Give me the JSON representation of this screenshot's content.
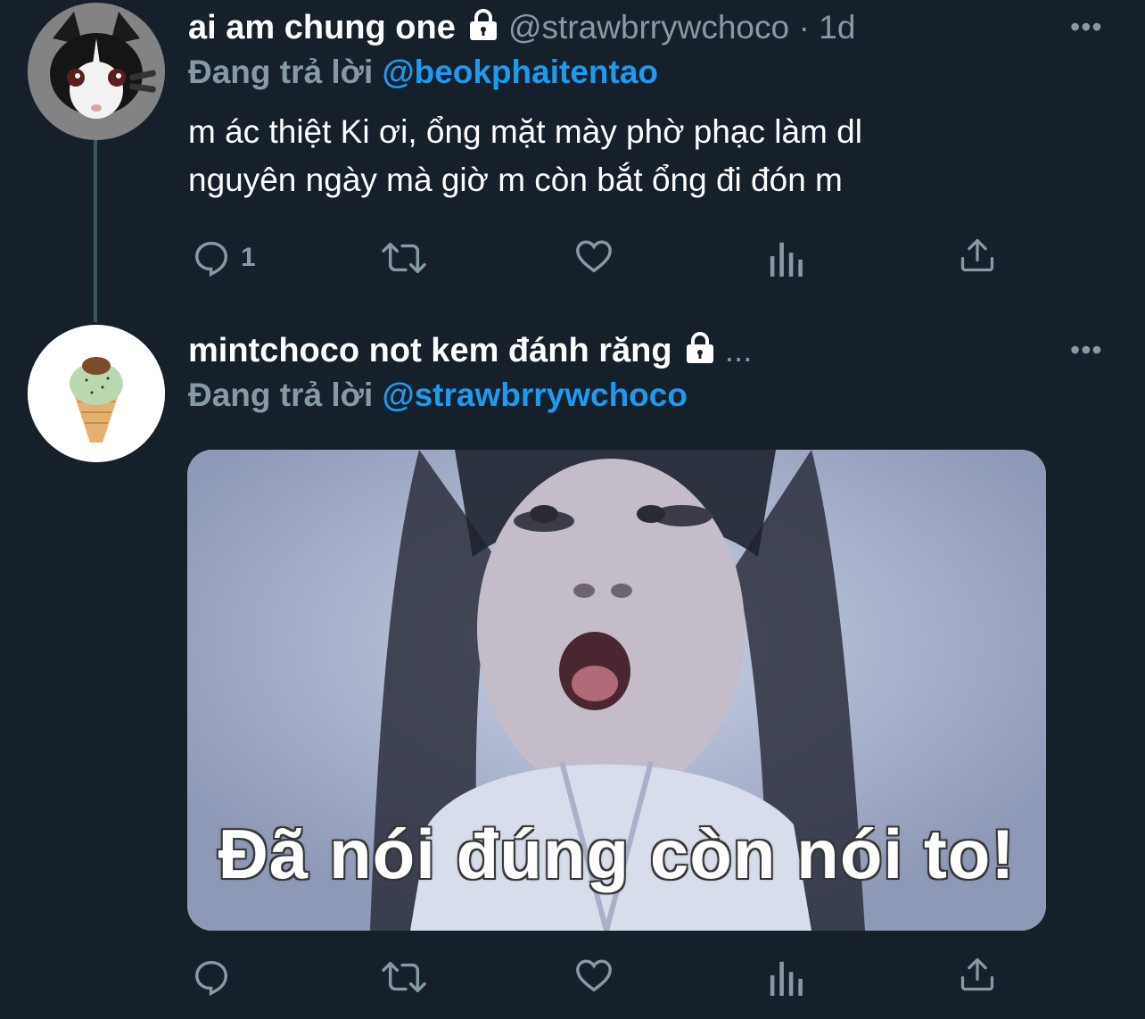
{
  "tweets": [
    {
      "display_name": "ai am chung one",
      "handle": "@strawbrrywchoco",
      "time": "· 1d",
      "reply_prefix": "Đang trả lời",
      "reply_to": "@beokphaitentao",
      "text_line1": "m ác thiệt Ki ơi, ổng mặt mày phờ phạc làm dl",
      "text_line2": "nguyên ngày mà giờ m còn bắt ổng đi đón m",
      "reply_count": "1",
      "more": "•••"
    },
    {
      "display_name": "mintchoco not kem đánh răng",
      "ellipsis": "...",
      "reply_prefix": "Đang trả lời",
      "reply_to": "@strawbrrywchoco",
      "media_caption": "Đã nói đúng còn nói to!",
      "more": "•••"
    }
  ],
  "colors": {
    "background": "#15202b",
    "text": "#ffffff",
    "muted": "#8899a6",
    "mention": "#1d9bf0"
  },
  "icons": [
    "lock-icon",
    "reply-icon",
    "retweet-icon",
    "like-icon",
    "analytics-icon",
    "share-icon",
    "more-icon"
  ]
}
